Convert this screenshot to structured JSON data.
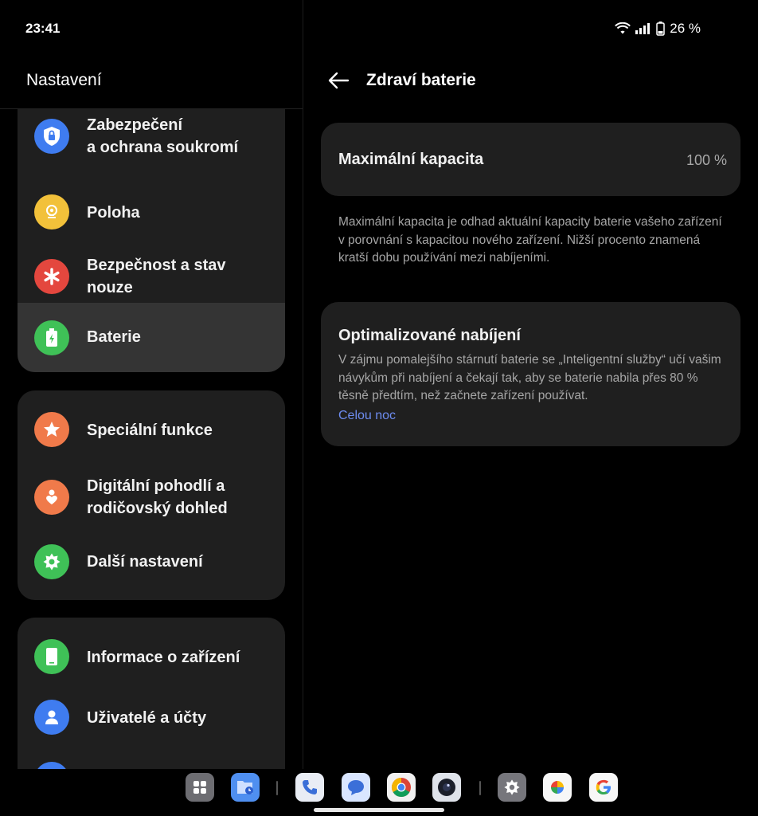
{
  "status_bar": {
    "time": "23:41",
    "battery_percent": "26 %",
    "icons": [
      "wifi-icon",
      "signal-icon",
      "battery-icon"
    ]
  },
  "left_pane": {
    "title": "Nastavení",
    "groups": [
      {
        "items": [
          {
            "label": "Zabezpečení a ochrana soukromí",
            "line1": "Zabezpečení",
            "line2": "a ochrana soukromí",
            "icon": "shield-lock-icon",
            "color": "#3f7cf0"
          },
          {
            "label": "Poloha",
            "icon": "location-icon",
            "color": "#f2c13a"
          },
          {
            "label": "Bezpečnost a stav nouze",
            "line1": "Bezpečnost a stav",
            "line2": "nouze",
            "icon": "emergency-asterisk-icon",
            "color": "#e4473e"
          },
          {
            "label": "Baterie",
            "icon": "battery-charging-icon",
            "color": "#3fc157",
            "selected": true
          }
        ]
      },
      {
        "items": [
          {
            "label": "Speciální funkce",
            "icon": "star-icon",
            "color": "#f07a4a"
          },
          {
            "label": "Digitální pohodlí a rodičovský dohled",
            "line1": "Digitální pohodlí a",
            "line2": "rodičovský dohled",
            "icon": "heart-person-icon",
            "color": "#f07a4a"
          },
          {
            "label": "Další nastavení",
            "icon": "gear-icon",
            "color": "#3fc157"
          }
        ]
      },
      {
        "items": [
          {
            "label": "Informace o zařízení",
            "icon": "phone-device-icon",
            "color": "#3fc157"
          },
          {
            "label": "Uživatelé a účty",
            "icon": "person-icon",
            "color": "#3f7cf0"
          }
        ]
      }
    ]
  },
  "right_pane": {
    "title": "Zdraví baterie",
    "capacity": {
      "label": "Maximální kapacita",
      "value": "100 %"
    },
    "capacity_description": "Maximální kapacita je odhad aktuální kapacity baterie vašeho zařízení v porovnání s kapacitou nového zařízení. Nižší procento znamená kratší dobu používání mezi nabíjeními.",
    "optimized": {
      "title": "Optimalizované nabíjení",
      "description": "V zájmu pomalejšího stárnutí baterie se „Inteligentní služby“ učí vašim návykům při nabíjení a čekají tak, aby se baterie nabila přes 80 % těsně předtím, než začnete zařízení používat.",
      "link": "Celou noc"
    }
  },
  "taskbar": {
    "apps": [
      "app-drawer-icon",
      "file-manager-icon",
      "phone-app-icon",
      "messages-app-icon",
      "chrome-app-icon",
      "camera-app-icon",
      "settings-app-icon",
      "photos-app-icon",
      "google-app-icon"
    ]
  }
}
